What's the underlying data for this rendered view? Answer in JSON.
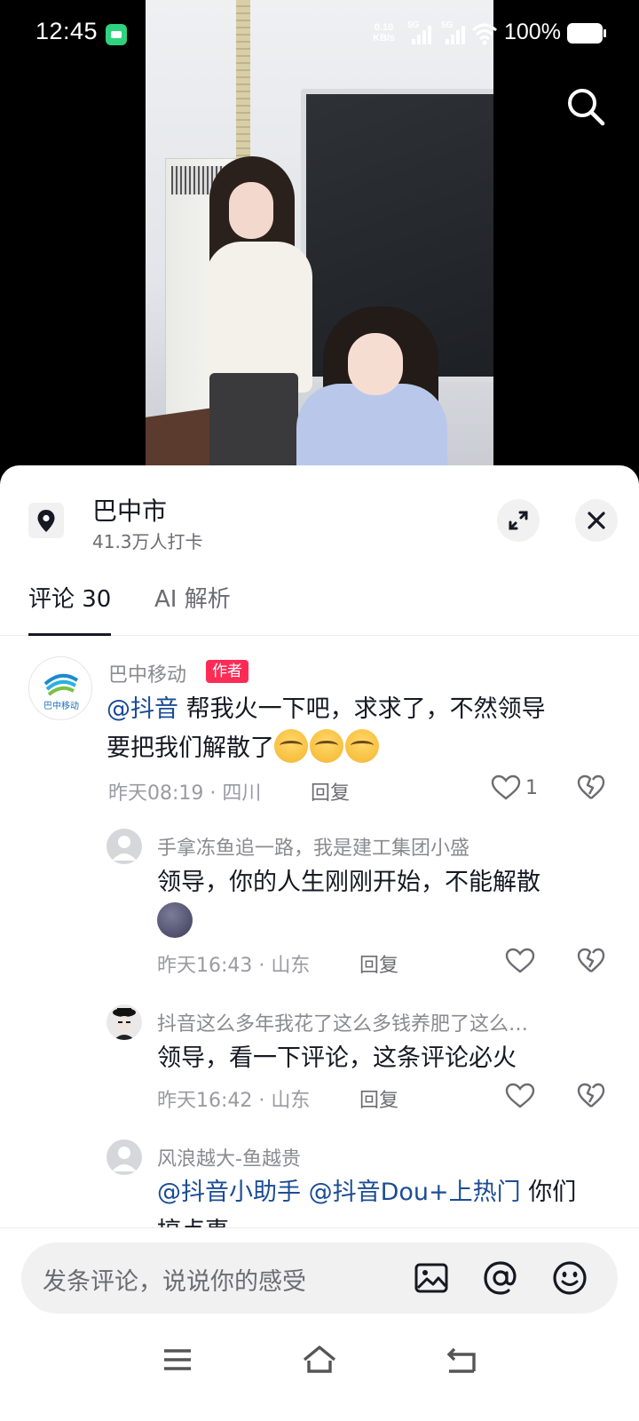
{
  "status_bar": {
    "time": "12:45",
    "speed_value": "0.10",
    "speed_unit": "KB/s",
    "net1": "5G",
    "net2": "5G",
    "battery": "100%"
  },
  "location": {
    "title": "巴中市",
    "subtitle": "41.3万人打卡"
  },
  "tabs": [
    {
      "label": "评论 30",
      "active": true
    },
    {
      "label": "AI 解析",
      "active": false
    }
  ],
  "comments": [
    {
      "nickname": "巴中移动",
      "badge": "作者",
      "avatar_text": "巴中移动",
      "mention": "@抖音",
      "text_line1": " 帮我火一下吧，求求了，不然领导",
      "text_line2": "要把我们解散了",
      "meta": "昨天08:19 · 四川",
      "reply": "回复",
      "likes": "1"
    },
    {
      "nickname": "手拿冻鱼追一路，我是建工集团小盛",
      "text": "领导，你的人生刚刚开始，不能解散",
      "meta": "昨天16:43 · 山东",
      "reply": "回复"
    },
    {
      "nickname": "抖音这么多年我花了这么多钱养肥了这么…",
      "text": "领导，看一下评论，这条评论必火",
      "meta": "昨天16:42 · 山东",
      "reply": "回复"
    },
    {
      "nickname": "风浪越大-鱼越贵",
      "mention1": "@抖音小助手",
      "mention2": "@抖音Dou+上热门",
      "text": " 你们",
      "text_line2": "搞点事"
    }
  ],
  "input": {
    "placeholder": "发条评论，说说你的感受"
  },
  "colors": {
    "accent": "#fe2c55",
    "mention": "#1b4c95"
  }
}
